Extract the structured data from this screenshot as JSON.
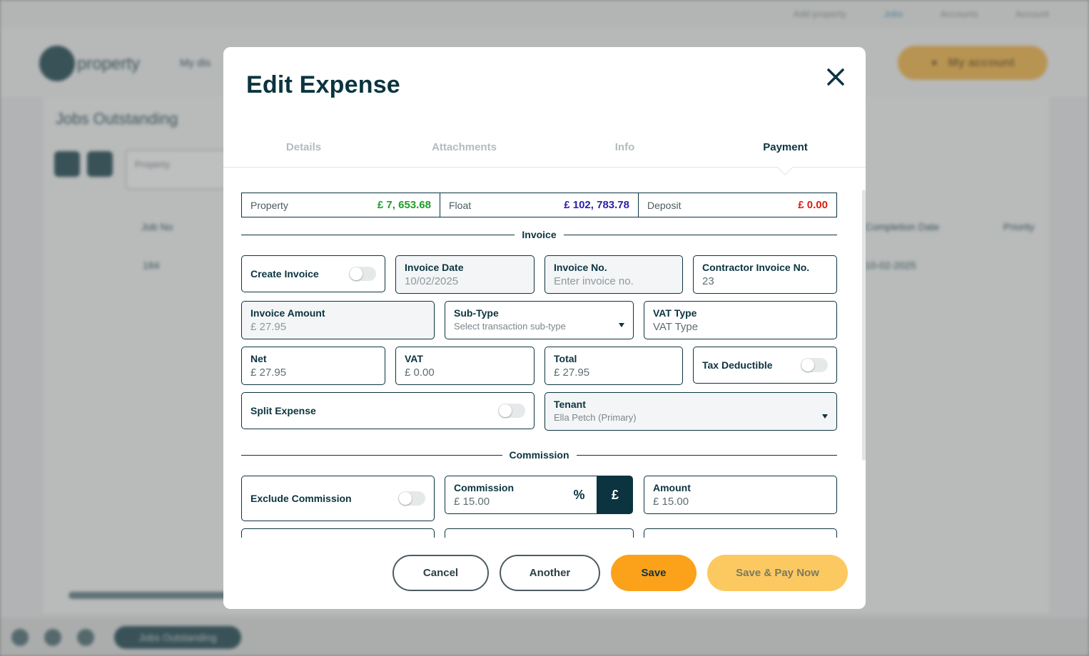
{
  "background": {
    "top_links": [
      "Add property",
      "Jobs",
      "Accounts",
      "Account"
    ],
    "logo_text": "property",
    "nav_item": "My dis",
    "my_account_label": "My account",
    "page_title": "Jobs Outstanding",
    "filter_label": "Property",
    "table_headers": [
      "Job No",
      "Completion Date",
      "Priority"
    ],
    "row_values": [
      "184",
      "10-02-2025"
    ],
    "footer_pill": "Jobs Outstanding"
  },
  "modal": {
    "title": "Edit Expense",
    "close_icon": "close-icon",
    "tabs": [
      {
        "label": "Details",
        "active": false
      },
      {
        "label": "Attachments",
        "active": false
      },
      {
        "label": "Info",
        "active": false
      },
      {
        "label": "Payment",
        "active": true
      }
    ],
    "balances": [
      {
        "label": "Property",
        "value": "£ 7, 653.68",
        "color": "#1f9d2a"
      },
      {
        "label": "Float",
        "value": "£ 102, 783.78",
        "color": "#2b1fa8"
      },
      {
        "label": "Deposit",
        "value": "£ 0.00",
        "color": "#d91e12"
      }
    ],
    "sections": {
      "invoice": "Invoice",
      "commission": "Commission"
    },
    "fields": {
      "create_invoice": {
        "label": "Create Invoice",
        "on": false
      },
      "invoice_date": {
        "label": "Invoice Date",
        "value": "10/02/2025"
      },
      "invoice_no": {
        "label": "Invoice No.",
        "placeholder": "Enter invoice no."
      },
      "contractor_invoice_no": {
        "label": "Contractor Invoice No.",
        "value": "23"
      },
      "invoice_amount": {
        "label": "Invoice Amount",
        "value": "£ 27.95"
      },
      "sub_type": {
        "label": "Sub-Type",
        "placeholder": "Select transaction sub-type"
      },
      "vat_type": {
        "label": "VAT Type",
        "value": "VAT Type"
      },
      "net": {
        "label": "Net",
        "value": "£ 27.95"
      },
      "vat": {
        "label": "VAT",
        "value": "£ 0.00"
      },
      "total": {
        "label": "Total",
        "value": "£ 27.95"
      },
      "tax_deductible": {
        "label": "Tax Deductible",
        "on": false
      },
      "split_expense": {
        "label": "Split Expense",
        "on": false
      },
      "tenant": {
        "label": "Tenant",
        "value": "Ella Petch (Primary)"
      },
      "exclude_commission": {
        "label": "Exclude Commission",
        "on": false
      },
      "commission": {
        "label": "Commission",
        "value": "£ 15.00",
        "unit_percent": "%",
        "unit_pound": "£",
        "selected_unit": "£"
      },
      "amount": {
        "label": "Amount",
        "value": "£ 15.00"
      }
    },
    "buttons": {
      "cancel": "Cancel",
      "another": "Another",
      "save": "Save",
      "save_pay": "Save & Pay Now"
    },
    "colors": {
      "primary_dark": "#0b3440",
      "accent_orange": "#fba21a",
      "accent_orange_soft": "#fcc961"
    }
  }
}
